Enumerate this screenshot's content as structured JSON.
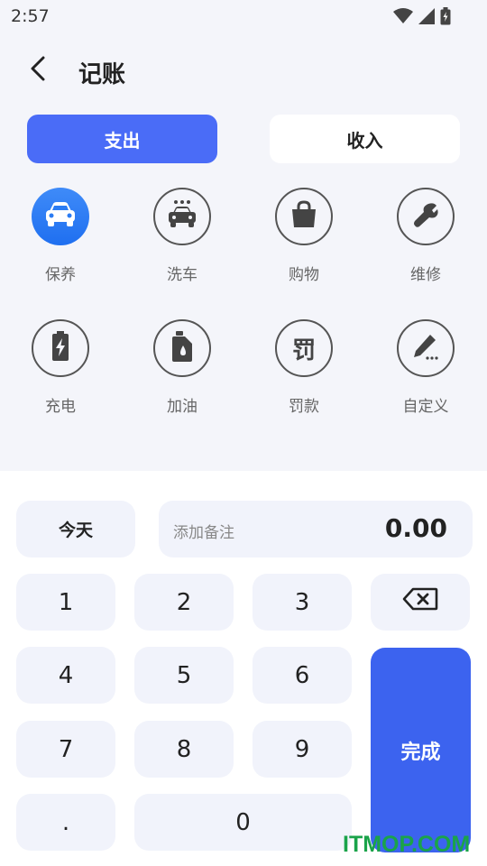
{
  "status_bar": {
    "time": "2:57"
  },
  "header": {
    "title": "记账"
  },
  "tabs": [
    {
      "label": "支出",
      "active": true
    },
    {
      "label": "收入",
      "active": false
    }
  ],
  "categories": [
    {
      "label": "保养",
      "icon": "car-icon",
      "active": true
    },
    {
      "label": "洗车",
      "icon": "car-wash-icon",
      "active": false
    },
    {
      "label": "购物",
      "icon": "shopping-bag-icon",
      "active": false
    },
    {
      "label": "维修",
      "icon": "wrench-icon",
      "active": false
    },
    {
      "label": "充电",
      "icon": "battery-charge-icon",
      "active": false
    },
    {
      "label": "加油",
      "icon": "oil-can-icon",
      "active": false
    },
    {
      "label": "罚款",
      "icon": "fine-icon",
      "active": false
    },
    {
      "label": "自定义",
      "icon": "pencil-icon",
      "active": false
    }
  ],
  "fine_glyph": "罚",
  "input": {
    "date_label": "今天",
    "note_placeholder": "添加备注",
    "amount": "0.00"
  },
  "keypad": {
    "keys": [
      "1",
      "2",
      "3",
      "4",
      "5",
      "6",
      "7",
      "8",
      "9",
      ".",
      "0"
    ],
    "done_label": "完成"
  },
  "watermark": "ITMOP.COM",
  "colors": {
    "accent": "#4a6cf7",
    "done": "#3c63ef",
    "key_bg": "#f1f3fb"
  }
}
